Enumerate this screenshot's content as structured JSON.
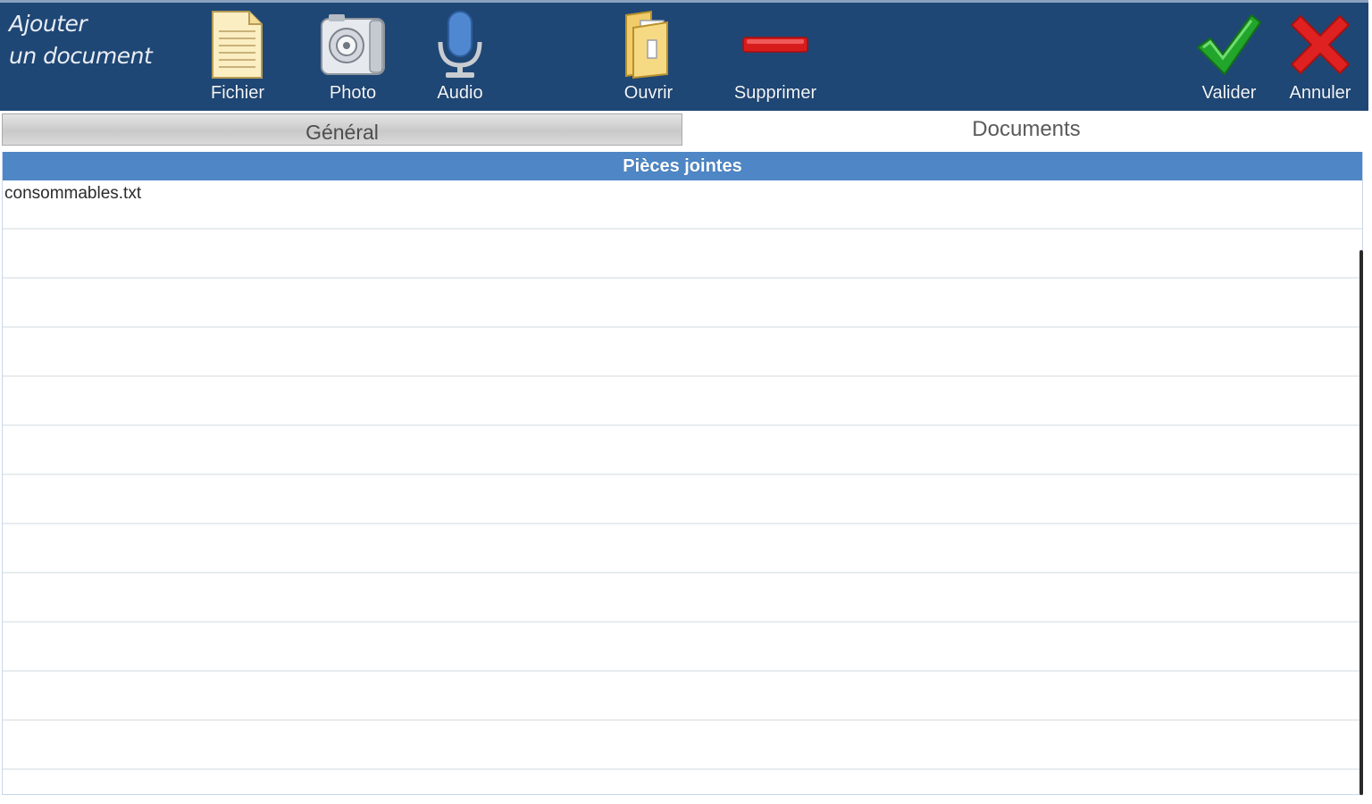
{
  "header": {
    "title_line1": "Ajouter",
    "title_line2": "un document"
  },
  "toolbar": {
    "fichier": {
      "label": "Fichier",
      "icon": "document-icon"
    },
    "photo": {
      "label": "Photo",
      "icon": "camera-icon"
    },
    "audio": {
      "label": "Audio",
      "icon": "microphone-icon"
    },
    "ouvrir": {
      "label": "Ouvrir",
      "icon": "folder-icon"
    },
    "supprimer": {
      "label": "Supprimer",
      "icon": "minus-icon"
    },
    "valider": {
      "label": "Valider",
      "icon": "checkmark-icon"
    },
    "annuler": {
      "label": "Annuler",
      "icon": "x-icon"
    }
  },
  "tabs": {
    "general": "Général",
    "documents": "Documents",
    "active": "Documents"
  },
  "attachments": {
    "header": "Pièces jointes",
    "items": [
      "consommables.txt"
    ]
  },
  "colors": {
    "toolbar_bg": "#1f4775",
    "list_header_bg": "#4f87c6",
    "valider": "#22a52b",
    "annuler": "#e02121",
    "supprimer": "#d81c1c"
  }
}
